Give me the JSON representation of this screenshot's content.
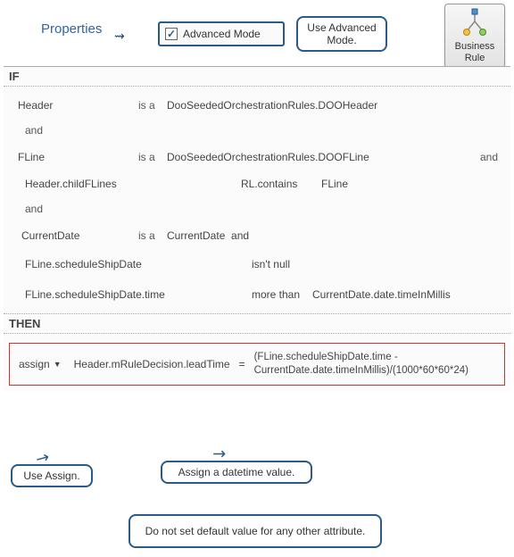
{
  "header": {
    "properties_label": "Properties",
    "advanced_mode_label": "Advanced Mode",
    "callout_advanced": "Use Advanced Mode.",
    "business_rule_label": "Business Rule"
  },
  "ifthen": {
    "if_label": "IF",
    "then_label": "THEN",
    "is_a": "is a",
    "and": "and"
  },
  "conditions": {
    "c1_left": "Header",
    "c1_right": "DooSeededOrchestrationRules.DOOHeader",
    "c2_left": "FLine",
    "c2_right": "DooSeededOrchestrationRules.DOOFLine",
    "c3_left": "Header.childFLines",
    "c3_op": "RL.contains",
    "c3_right": "FLine",
    "c4_left": "CurrentDate",
    "c4_right": "CurrentDate",
    "c5_left": "FLine.scheduleShipDate",
    "c5_op": "isn't null",
    "c6_left": "FLine.scheduleShipDate.time",
    "c6_op": "more than",
    "c6_right": "CurrentDate.date.timeInMillis"
  },
  "action": {
    "assign_label": "assign",
    "target": "Header.mRuleDecision.leadTime",
    "equals": "=",
    "expression": "(FLine.scheduleShipDate.time - CurrentDate.date.timeInMillis)/(1000*60*60*24)"
  },
  "callouts": {
    "use_assign": "Use Assign.",
    "assign_datetime": "Assign a datetime value.",
    "no_default": "Do not set default value for any other attribute."
  }
}
